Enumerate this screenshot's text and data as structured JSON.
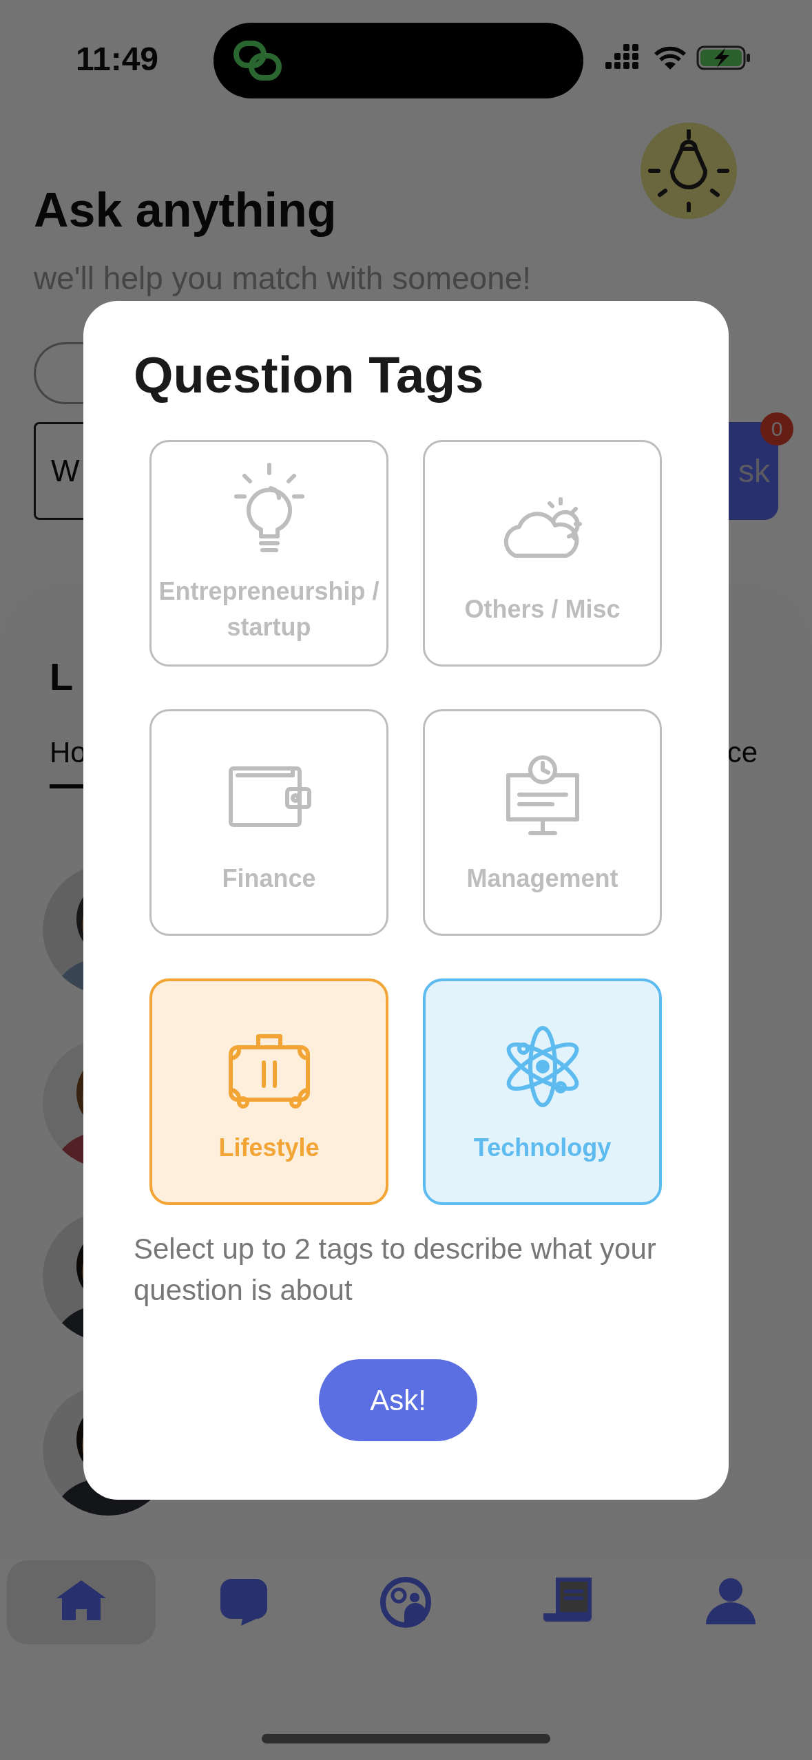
{
  "status_bar": {
    "time": "11:49"
  },
  "header": {
    "title": "Ask anything",
    "subtitle": "we'll help you match with someone!"
  },
  "question_field": {
    "value": "W"
  },
  "ask_button": {
    "label": "sk",
    "badge": "0"
  },
  "leaders": {
    "heading": "L",
    "tabs": [
      {
        "label": "Ho",
        "selected": true
      },
      {
        "label": "ce",
        "selected": false
      }
    ],
    "people": [
      {
        "kind": "avatar"
      },
      {
        "kind": "avatar"
      },
      {
        "kind": "avatar"
      },
      {
        "kind": "avatar"
      }
    ]
  },
  "nav": [
    {
      "selected": true
    },
    {
      "selected": false
    },
    {
      "selected": false
    },
    {
      "selected": false
    },
    {
      "selected": false
    }
  ],
  "modal": {
    "title": "Question Tags",
    "tags": [
      {
        "label": "Entrepreneurship / startup",
        "selected": false,
        "color": "#bdbdbd"
      },
      {
        "label": "Others / Misc",
        "selected": false,
        "color": "#bdbdbd"
      },
      {
        "label": "Finance",
        "selected": false,
        "color": "#bdbdbd"
      },
      {
        "label": "Management",
        "selected": false,
        "color": "#bdbdbd"
      },
      {
        "label": "Lifestyle",
        "selected": true,
        "color": "#f2a535"
      },
      {
        "label": "Technology",
        "selected": true,
        "color": "#5dbbef"
      }
    ],
    "hint": "Select up to 2 tags to describe what your question is about",
    "button": "Ask!"
  }
}
